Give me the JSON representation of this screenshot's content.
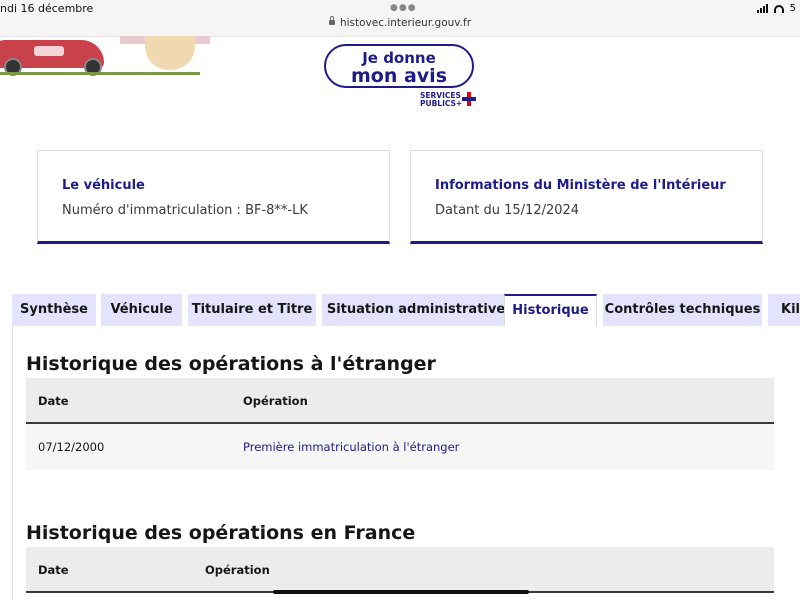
{
  "status_bar": {
    "date": "ndi 16 décembre",
    "url": "histovec.interieur.gouv.fr",
    "battery": "5"
  },
  "feedback": {
    "line1": "Je donne",
    "line2": "mon avis",
    "brand_line1": "SERVICES",
    "brand_line2": "PUBLICS+"
  },
  "cards": [
    {
      "title": "Le véhicule",
      "subtitle": "Numéro d'immatriculation : BF-8**-LK"
    },
    {
      "title": "Informations du Ministère de l'Intérieur",
      "subtitle": "Datant du 15/12/2024"
    }
  ],
  "tabs": [
    {
      "label": "Synthèse",
      "active": false
    },
    {
      "label": "Véhicule",
      "active": false
    },
    {
      "label": "Titulaire et Titre",
      "active": false
    },
    {
      "label": "Situation administrative",
      "active": false
    },
    {
      "label": "Historique",
      "active": true
    },
    {
      "label": "Contrôles techniques",
      "active": false
    },
    {
      "label": "Kilo",
      "active": false
    }
  ],
  "foreign": {
    "heading": "Historique des opérations à l'étranger",
    "col_date": "Date",
    "col_operation": "Opération",
    "rows": [
      {
        "date": "07/12/2000",
        "operation": "Première immatriculation à l'étranger"
      }
    ]
  },
  "france": {
    "heading": "Historique des opérations en France",
    "col_date": "Date",
    "col_operation": "Opération"
  },
  "colors": {
    "accent": "#1d1c89",
    "tab_bg": "#e3e3fd",
    "marianne_red": "#e1000f"
  }
}
